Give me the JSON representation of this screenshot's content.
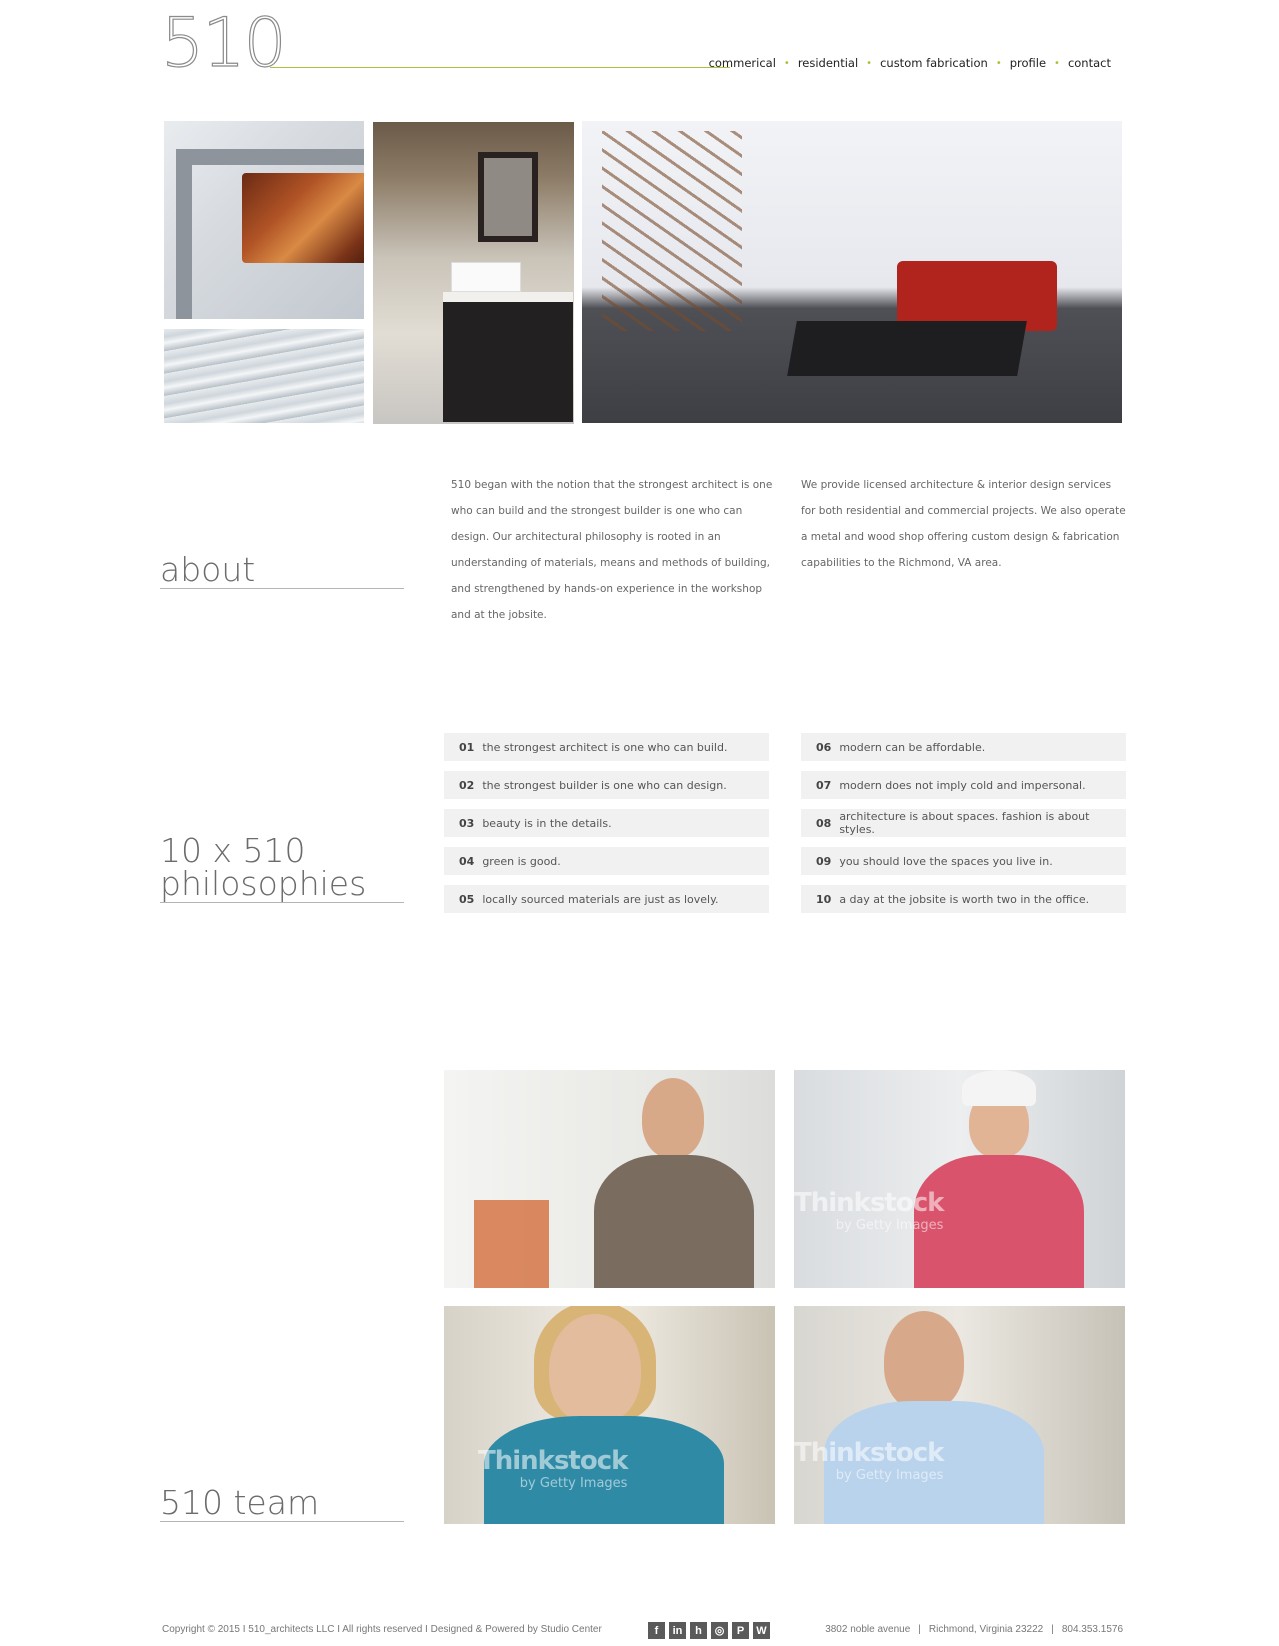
{
  "header": {
    "logo": "510",
    "nav": [
      "commerical",
      "residential",
      "custom fabrication",
      "profile",
      "contact"
    ]
  },
  "about": {
    "heading": "about",
    "col1": "510 began with the notion that the strongest architect is one who can build and the strongest builder is one who can design. Our architectural philosophy is rooted in an understanding of materials, means and methods of building, and strengthened by hands-on experience in the workshop and at the jobsite.",
    "col2": "We provide licensed architecture & interior design services for both residential and commercial projects. We also operate a metal and wood shop offering custom design & fabrication capabilities to the Richmond, VA area."
  },
  "philosophies": {
    "heading_line1": "10 x 510",
    "heading_line2": "philosophies",
    "items": [
      {
        "num": "01",
        "text": "the strongest architect is one who can build."
      },
      {
        "num": "02",
        "text": "the strongest builder is one who can design."
      },
      {
        "num": "03",
        "text": "beauty is in the details."
      },
      {
        "num": "04",
        "text": "green is good."
      },
      {
        "num": "05",
        "text": "locally sourced materials are just as lovely."
      },
      {
        "num": "06",
        "text": "modern can be affordable."
      },
      {
        "num": "07",
        "text": "modern does not imply cold and impersonal."
      },
      {
        "num": "08",
        "text": "architecture is about spaces. fashion is about styles."
      },
      {
        "num": "09",
        "text": "you should love the spaces you live in."
      },
      {
        "num": "10",
        "text": "a day at the jobsite is worth two in the office."
      }
    ]
  },
  "team": {
    "heading": "510 team",
    "watermark": "Thinkstock",
    "watermark_sub": "by Getty Images"
  },
  "footer": {
    "copyright": "Copyright © 2015 I 510_architects LLC I All rights reserved  I  Designed & Powered by Studio Center",
    "social": [
      "facebook-icon",
      "linkedin-icon",
      "houzz-icon",
      "instagram-icon",
      "pinterest-icon",
      "wordpress-icon"
    ],
    "address": "3802 noble avenue",
    "city": "Richmond, Virginia 23222",
    "phone": "804.353.1576"
  },
  "colors": {
    "accent": "#a9c43a",
    "text": "#555555",
    "phil_bg": "#f1f1f1"
  }
}
